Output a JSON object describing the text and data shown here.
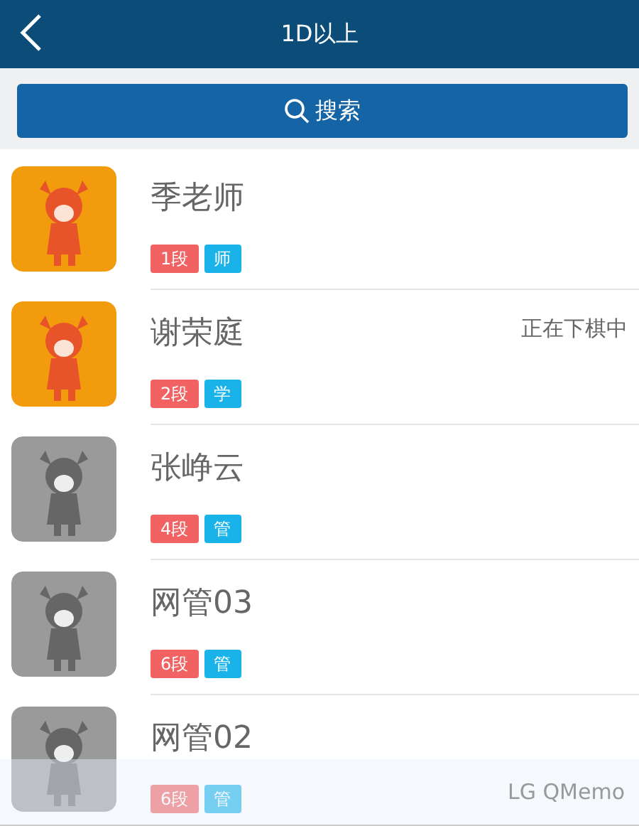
{
  "header": {
    "title": "1D以上"
  },
  "search_button": {
    "label": "搜索"
  },
  "players": [
    {
      "name": "季老师",
      "online": true,
      "rank": "1段",
      "role": "师"
    },
    {
      "name": "谢荣庭",
      "online": true,
      "rank": "2段",
      "role": "学",
      "status": "正在下棋中"
    },
    {
      "name": "张峥云",
      "online": false,
      "rank": "4段",
      "role": "管"
    },
    {
      "name": "网管03",
      "online": false,
      "rank": "6段",
      "role": "管"
    },
    {
      "name": "网管02",
      "online": false,
      "rank": "6段",
      "role": "管"
    }
  ],
  "overlay": {
    "label": "LG QMemo"
  }
}
